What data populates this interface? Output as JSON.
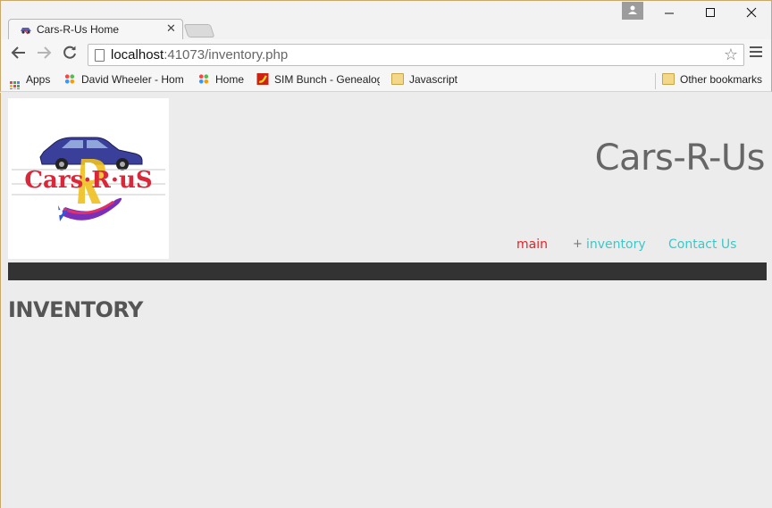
{
  "browser": {
    "tab_title": "Cars-R-Us Home",
    "url_host": "localhost",
    "url_rest": ":41073/inventory.php",
    "bookmarks": [
      {
        "label": "Apps",
        "icon": "apps-grid-icon"
      },
      {
        "label": "David Wheeler - Hom",
        "icon": "joomla-icon"
      },
      {
        "label": "Home",
        "icon": "joomla-icon"
      },
      {
        "label": "SIM Bunch - Genealog",
        "icon": "banana-icon"
      },
      {
        "label": "Javascript",
        "icon": "folder-icon"
      }
    ],
    "other_bookmarks": "Other bookmarks"
  },
  "site": {
    "title": "Cars-R-Us",
    "logo_text": "Cars·R·uS",
    "nav": {
      "main": "main",
      "plus": "+",
      "inventory": "inventory",
      "contact": "Contact Us"
    },
    "heading": "INVENTORY"
  },
  "colors": {
    "nav_active": "#e0242b",
    "nav_link": "#3cc8c8",
    "bar": "#333333"
  }
}
